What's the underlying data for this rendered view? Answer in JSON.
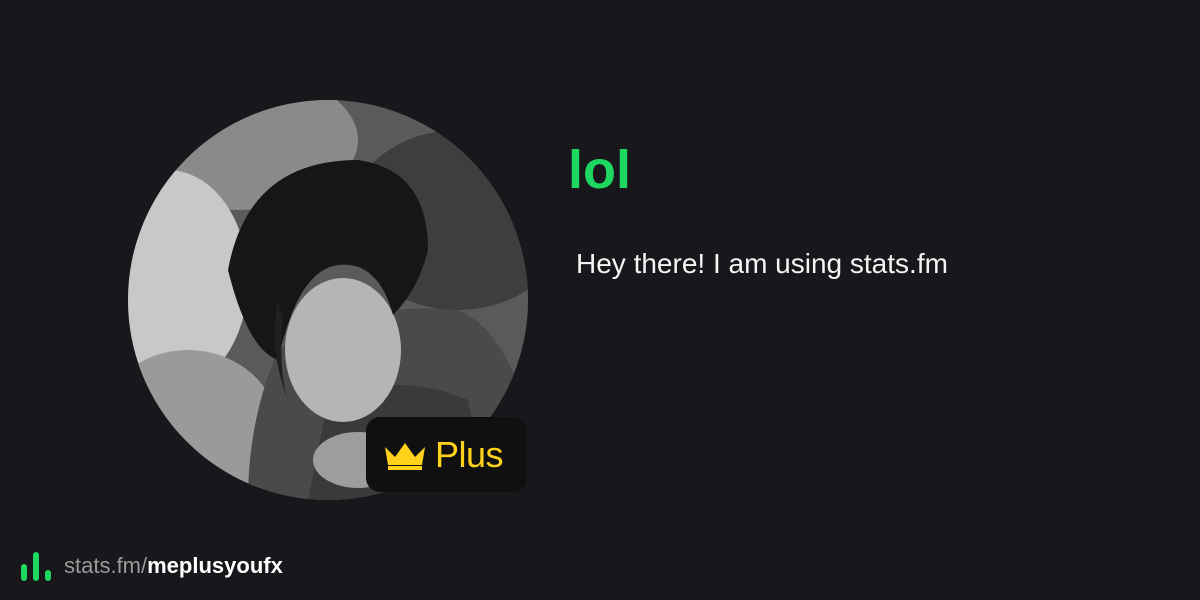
{
  "profile": {
    "username": "lol",
    "bio": "Hey there! I am using stats.fm",
    "badge_label": "Plus",
    "avatar_icon": "profile-photo",
    "badge_icon": "crown-icon"
  },
  "footer": {
    "domain": "stats.fm/",
    "handle": "meplusyoufx",
    "logo_icon": "stats-fm-logo-icon"
  },
  "colors": {
    "background": "#18181c",
    "accent_green": "#1ed760",
    "plus_yellow": "#ffd11a",
    "badge_background": "#101010"
  }
}
